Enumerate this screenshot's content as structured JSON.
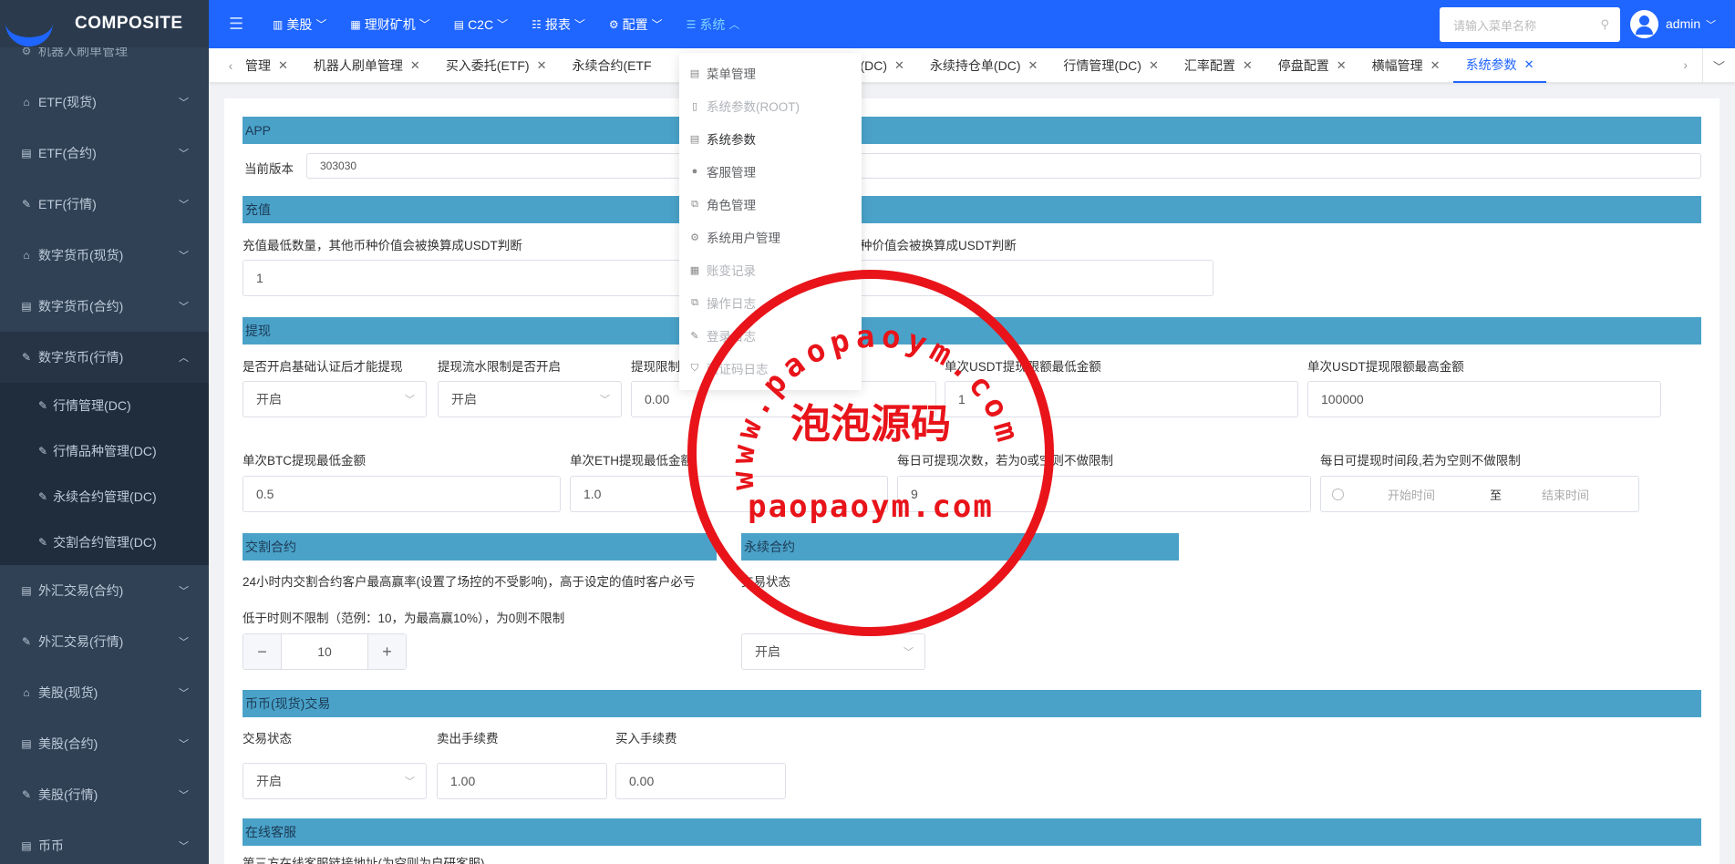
{
  "app": {
    "title": "COMPOSITE"
  },
  "sidebar": {
    "top_partial": "机器人刷单管理",
    "items": [
      {
        "label": "ETF(现货)",
        "icon": "shop-icon"
      },
      {
        "label": "ETF(合约)",
        "icon": "doc-icon"
      },
      {
        "label": "ETF(行情)",
        "icon": "edit-icon"
      },
      {
        "label": "数字货币(现货)",
        "icon": "shop-icon"
      },
      {
        "label": "数字货币(合约)",
        "icon": "doc-icon"
      },
      {
        "label": "数字货币(行情)",
        "icon": "edit-icon",
        "open": true
      }
    ],
    "sub_items": [
      {
        "label": "行情管理(DC)"
      },
      {
        "label": "行情品种管理(DC)"
      },
      {
        "label": "永续合约管理(DC)"
      },
      {
        "label": "交割合约管理(DC)"
      }
    ],
    "items_after": [
      {
        "label": "外汇交易(合约)",
        "icon": "doc-icon"
      },
      {
        "label": "外汇交易(行情)",
        "icon": "edit-icon"
      },
      {
        "label": "美股(现货)",
        "icon": "shop-icon"
      },
      {
        "label": "美股(合约)",
        "icon": "doc-icon"
      },
      {
        "label": "美股(行情)",
        "icon": "edit-icon"
      },
      {
        "label": "币币",
        "icon": "doc-icon"
      }
    ]
  },
  "topnav": {
    "items": [
      {
        "label": "美股"
      },
      {
        "label": "理财矿机"
      },
      {
        "label": "C2C"
      },
      {
        "label": "报表"
      },
      {
        "label": "配置"
      },
      {
        "label": "系统",
        "active": true
      }
    ],
    "search_placeholder": "请输入菜单名称",
    "user": "admin"
  },
  "tabs": [
    {
      "label": "管理"
    },
    {
      "label": "机器人刷单管理"
    },
    {
      "label": "买入委托(ETF)"
    },
    {
      "label": "永续合约(ETF"
    },
    {
      "label": "买入委托(DC)"
    },
    {
      "label": "永续持仓单(DC)"
    },
    {
      "label": "行情管理(DC)"
    },
    {
      "label": "汇率配置"
    },
    {
      "label": "停盘配置"
    },
    {
      "label": "横幅管理"
    },
    {
      "label": "系统参数",
      "active": true
    }
  ],
  "dropdown": [
    {
      "label": "菜单管理",
      "faded": false
    },
    {
      "label": "系统参数(ROOT)",
      "faded": true
    },
    {
      "label": "系统参数",
      "faded": false,
      "selected": true
    },
    {
      "label": "客服管理",
      "faded": false
    },
    {
      "label": "角色管理",
      "faded": false
    },
    {
      "label": "系统用户管理",
      "faded": false
    },
    {
      "label": "账变记录",
      "faded": true
    },
    {
      "label": "操作日志",
      "faded": true
    },
    {
      "label": "登录日志",
      "faded": true
    },
    {
      "label": "验证码日志",
      "faded": true
    }
  ],
  "form": {
    "app": {
      "title": "APP",
      "version_label": "当前版本",
      "version_value": "303030"
    },
    "recharge": {
      "title": "充值",
      "min_label": "充值最低数量，其他币种价值会被换算成USDT判断",
      "min_value": "1",
      "label2": "种价值会被换算成USDT判断"
    },
    "withdraw": {
      "title": "提现",
      "labels": [
        "是否开启基础认证后才能提现",
        "提现流水限制是否开启",
        "提现限制",
        "单次USDT提现限额最低金额",
        "单次USDT提现限额最高金额"
      ],
      "values": [
        "开启",
        "开启",
        "0.00",
        "1",
        "100000"
      ],
      "labels2": [
        "单次BTC提现最低金额",
        "单次ETH提现最低金额",
        "每日可提现次数，若为0或空则不做限制",
        "每日可提现时间段,若为空则不做限制"
      ],
      "values2": [
        "0.5",
        "1.0",
        "9"
      ],
      "time_start": "开始时间",
      "time_sep": "至",
      "time_end": "结束时间"
    },
    "delivery": {
      "title": "交割合约",
      "desc1": "24小时内交割合约客户最高赢率(设置了场控的不受影响)，高于设定的值时客户必亏",
      "desc2": "低于时则不限制（范例：10，为最高赢10%），为0则不限制",
      "value": "10",
      "minus": "−",
      "plus": "+"
    },
    "perpetual": {
      "title": "永续合约",
      "status_label": "交易状态",
      "status_value": "开启"
    },
    "spot": {
      "title": "币币(现货)交易",
      "labels": [
        "交易状态",
        "卖出手续费",
        "买入手续费"
      ],
      "values": [
        "开启",
        "1.00",
        "0.00"
      ]
    },
    "online_service": {
      "title": "在线客服",
      "partial": "第三方在线客服链接地址(为空则为自研客服)"
    }
  },
  "watermark": {
    "top_arc": "www.paopaoym.com",
    "center": "泡泡源码",
    "bottom": "paopaoym.com",
    "color": "#e8141a"
  }
}
